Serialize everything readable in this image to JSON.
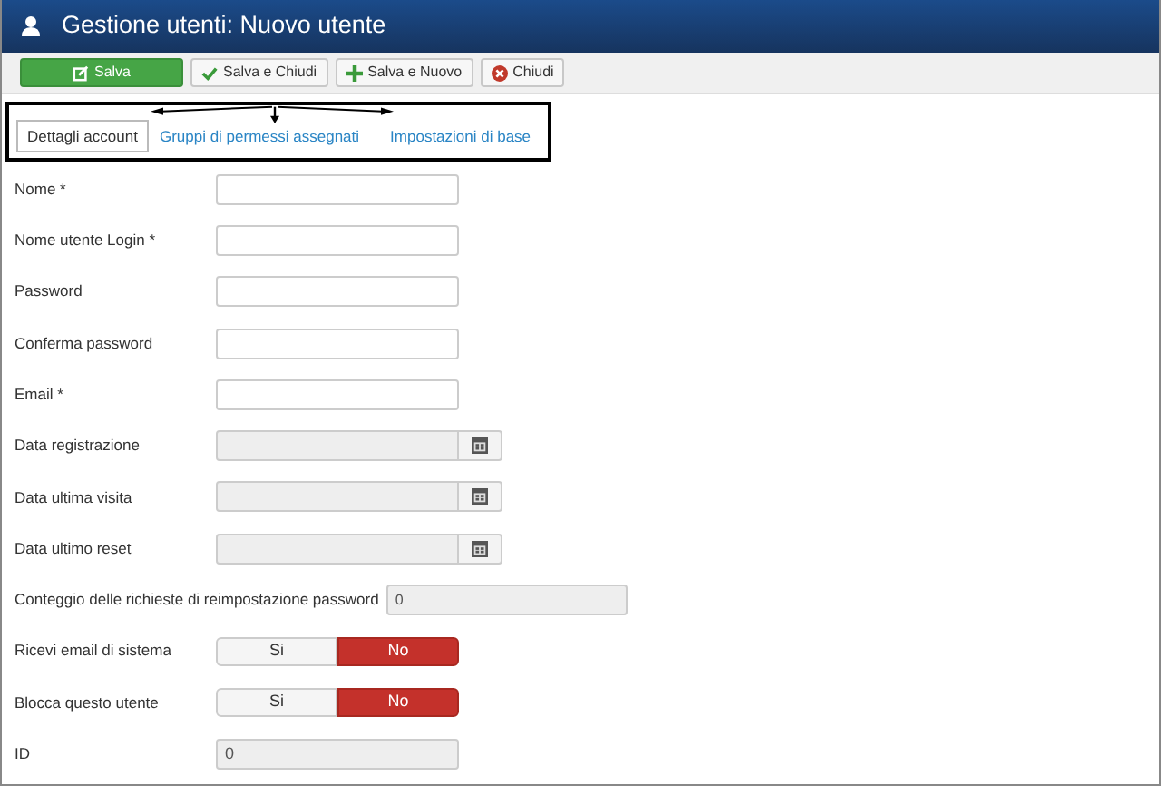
{
  "window": {
    "title": "Gestione utenti: Nuovo utente"
  },
  "toolbar": [
    {
      "label": "Salva",
      "kind": "save"
    },
    {
      "label": "Salva e Chiudi",
      "kind": "check"
    },
    {
      "label": "Salva e Nuovo",
      "kind": "new"
    },
    {
      "label": "Chiudi",
      "kind": "close"
    }
  ],
  "tabs": [
    {
      "label": "Dettagli account",
      "selected": true
    },
    {
      "label": "Gruppi di permessi assegnati",
      "selected": false
    },
    {
      "label": "Impostazioni di base",
      "selected": false
    }
  ],
  "fields": [
    {
      "label": "Nome *",
      "kind": "text"
    },
    {
      "label": "Nome utente Login *",
      "kind": "text"
    },
    {
      "label": "Password",
      "kind": "text"
    },
    {
      "label": "Conferma password",
      "kind": "text"
    },
    {
      "label": "Email *",
      "kind": "text"
    },
    {
      "label": "Data registrazione",
      "kind": "date"
    },
    {
      "label": "Data ultima visita",
      "kind": "date"
    },
    {
      "label": "Data ultimo reset",
      "kind": "date"
    },
    {
      "label": "Conteggio delle richieste di reimpostazione password",
      "kind": "count",
      "value": "0"
    },
    {
      "label": "Ricevi email di sistema",
      "kind": "toggle",
      "options": [
        {
          "label": "Si",
          "selected": false
        },
        {
          "label": "No",
          "selected": true
        }
      ]
    },
    {
      "label": "Blocca questo utente",
      "kind": "toggle",
      "options": [
        {
          "label": "Si",
          "selected": false
        },
        {
          "label": "No",
          "selected": true
        }
      ]
    },
    {
      "label": "ID",
      "kind": "readonly",
      "value": "0"
    }
  ]
}
